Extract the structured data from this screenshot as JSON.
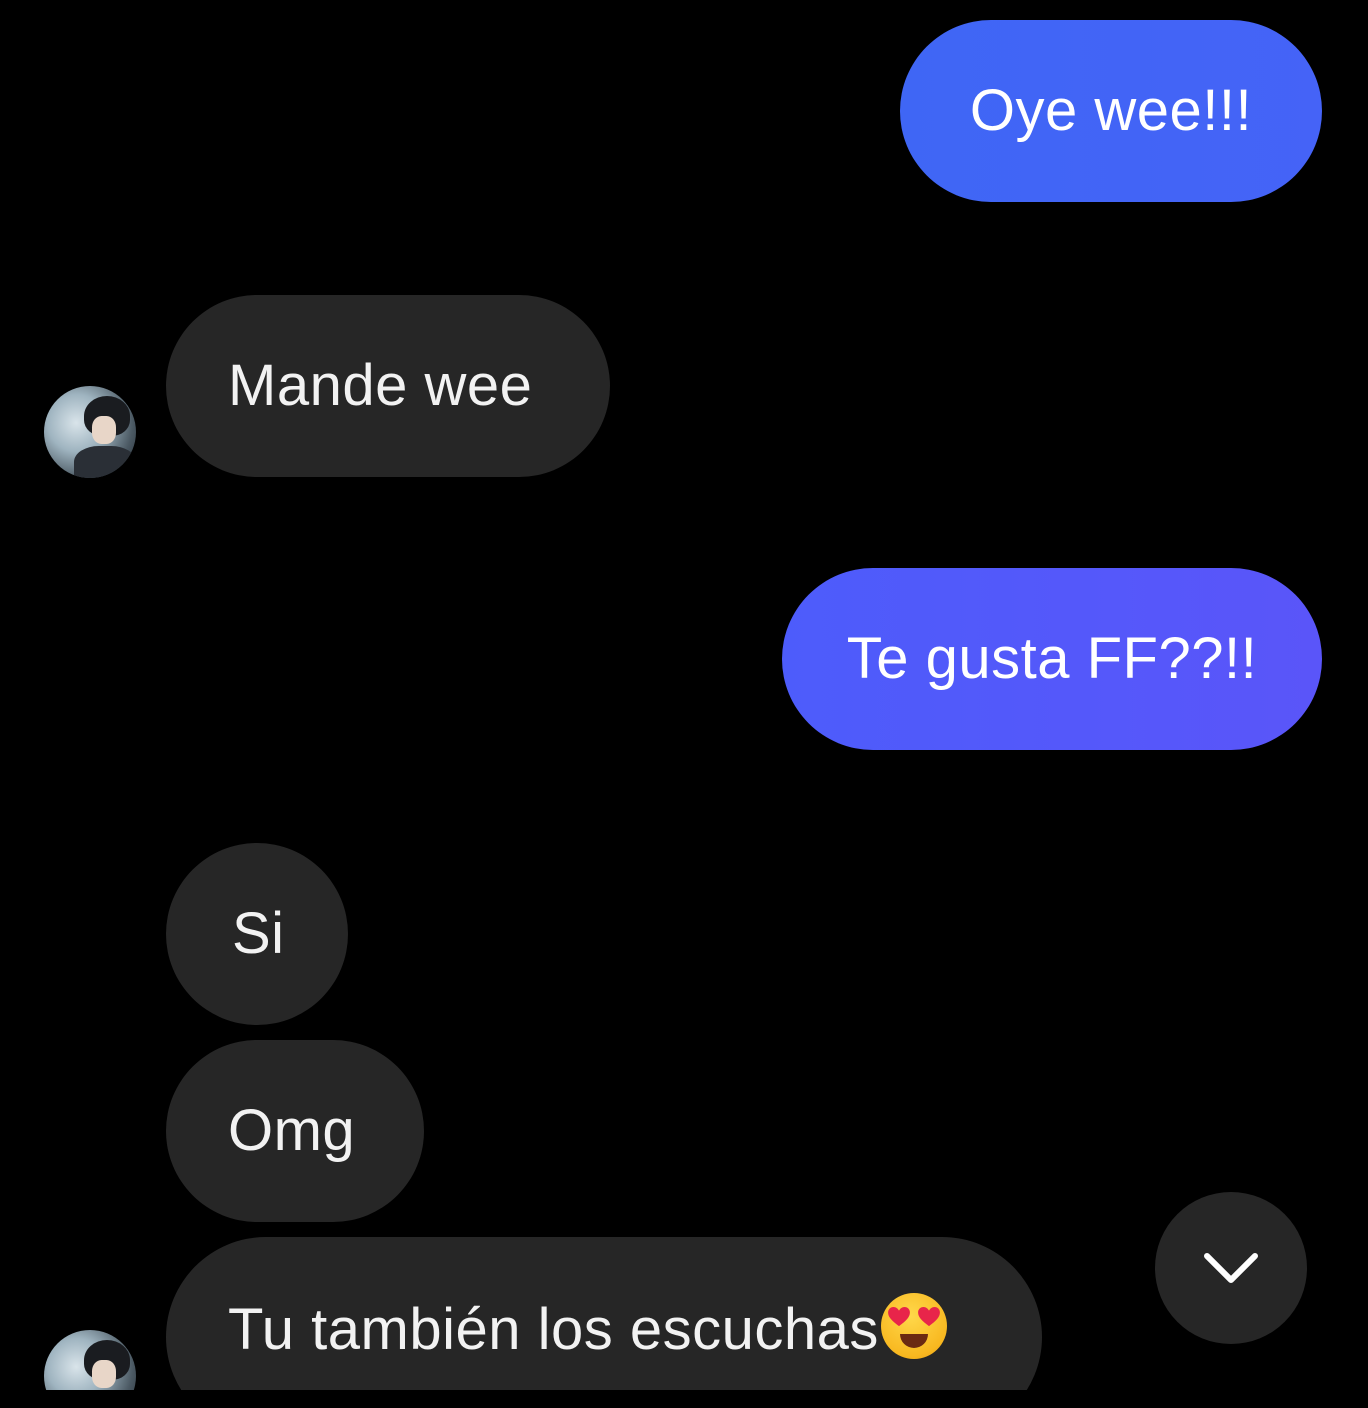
{
  "messages": [
    {
      "id": "msg-1",
      "direction": "outgoing",
      "text": "Oye wee!!!"
    },
    {
      "id": "msg-2",
      "direction": "incoming",
      "text": "Mande wee"
    },
    {
      "id": "msg-3",
      "direction": "outgoing",
      "text": "Te gusta FF??!!"
    },
    {
      "id": "msg-4",
      "direction": "incoming",
      "text": "Si"
    },
    {
      "id": "msg-5",
      "direction": "incoming",
      "text": "Omg"
    },
    {
      "id": "msg-6",
      "direction": "incoming",
      "text": "Tu también los escuchas",
      "emoji": "smiling-face-with-heart-eyes"
    }
  ],
  "scroll_button": {
    "icon": "chevron-down-icon"
  },
  "colors": {
    "background": "#000000",
    "outgoing_bubble_start": "#3f66f5",
    "outgoing_bubble_end": "#5a55f9",
    "incoming_bubble": "#262626",
    "text": "#ffffff"
  }
}
